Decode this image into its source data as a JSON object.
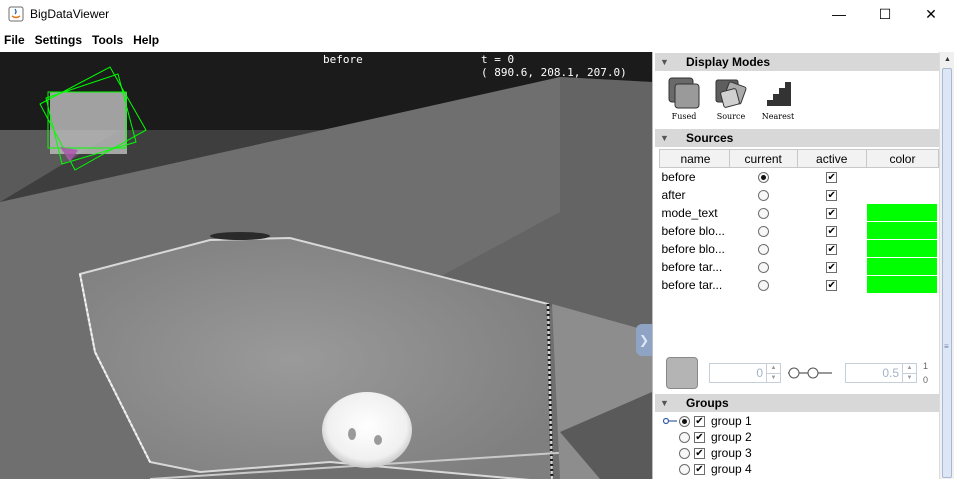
{
  "window": {
    "title": "BigDataViewer",
    "controls": {
      "minimize": "—",
      "maximize": "☐",
      "close": "✕"
    }
  },
  "menu": [
    "File",
    "Settings",
    "Tools",
    "Help"
  ],
  "viewer": {
    "source_name": "before",
    "time_label": "t = 0",
    "coordinates": "( 890.6, 208.1, 207.0)",
    "handle_glyph": "❯"
  },
  "display_modes": {
    "header": "Display Modes",
    "modes": [
      {
        "label": "Fused",
        "icon": "fused-mode-icon"
      },
      {
        "label": "Source",
        "icon": "source-mode-icon"
      },
      {
        "label": "Nearest",
        "icon": "nearest-mode-icon"
      }
    ]
  },
  "sources": {
    "header": "Sources",
    "columns": [
      "name",
      "current",
      "active",
      "color"
    ],
    "rows": [
      {
        "name": "before",
        "current": true,
        "active": true,
        "color": null
      },
      {
        "name": "after",
        "current": false,
        "active": true,
        "color": null
      },
      {
        "name": "mode_text",
        "current": false,
        "active": true,
        "color": "#00ff00"
      },
      {
        "name": "before blo...",
        "current": false,
        "active": true,
        "color": "#00ff00"
      },
      {
        "name": "before blo...",
        "current": false,
        "active": true,
        "color": "#00ff00"
      },
      {
        "name": "before tar...",
        "current": false,
        "active": true,
        "color": "#00ff00"
      },
      {
        "name": "before tar...",
        "current": false,
        "active": true,
        "color": "#00ff00"
      }
    ]
  },
  "brightness": {
    "min_value": "0",
    "max_value": "0.5",
    "range_top": "1",
    "range_bottom": "0"
  },
  "groups": {
    "header": "Groups",
    "items": [
      {
        "label": "group 1",
        "current": true,
        "active": true
      },
      {
        "label": "group 2",
        "current": false,
        "active": true
      },
      {
        "label": "group 3",
        "current": false,
        "active": true
      },
      {
        "label": "group 4",
        "current": false,
        "active": true
      }
    ]
  },
  "colors": {
    "overlay_green": "#00ff00",
    "viewer_background": "#1c1c1c",
    "scrollbar_thumb": "#dde6f4"
  }
}
